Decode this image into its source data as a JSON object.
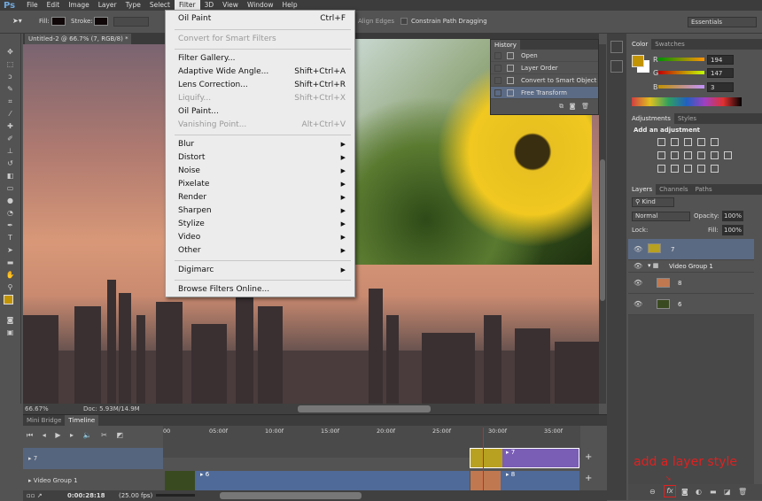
{
  "app": {
    "logo": "Ps"
  },
  "menubar": [
    "File",
    "Edit",
    "Image",
    "Layer",
    "Type",
    "Select",
    "Filter",
    "3D",
    "View",
    "Window",
    "Help"
  ],
  "options": {
    "fill": "Fill:",
    "stroke": "Stroke:",
    "align_edges": "Align Edges",
    "constrain": "Constrain Path Dragging",
    "workspace": "Essentials"
  },
  "document": {
    "tab": "Untitled-2 @ 66.7% (7, RGB/8) *",
    "close": "×",
    "zoom": "66.67%",
    "doc_size": "Doc: 5.93M/14.9M"
  },
  "filter_menu": [
    {
      "label": "Oil Paint",
      "shortcut": "Ctrl+F"
    },
    {
      "label": "Convert for Smart Filters",
      "disabled": true
    },
    {
      "label": "Filter Gallery..."
    },
    {
      "label": "Adaptive Wide Angle...",
      "shortcut": "Shift+Ctrl+A"
    },
    {
      "label": "Lens Correction...",
      "shortcut": "Shift+Ctrl+R"
    },
    {
      "label": "Liquify...",
      "shortcut": "Shift+Ctrl+X",
      "disabled": true
    },
    {
      "label": "Oil Paint..."
    },
    {
      "label": "Vanishing Point...",
      "shortcut": "Alt+Ctrl+V",
      "disabled": true
    },
    {
      "label": "Blur",
      "submenu": true
    },
    {
      "label": "Distort",
      "submenu": true
    },
    {
      "label": "Noise",
      "submenu": true
    },
    {
      "label": "Pixelate",
      "submenu": true
    },
    {
      "label": "Render",
      "submenu": true
    },
    {
      "label": "Sharpen",
      "submenu": true
    },
    {
      "label": "Stylize",
      "submenu": true
    },
    {
      "label": "Video",
      "submenu": true
    },
    {
      "label": "Other",
      "submenu": true
    },
    {
      "label": "Digimarc",
      "submenu": true
    },
    {
      "label": "Browse Filters Online..."
    }
  ],
  "history": {
    "title": "History",
    "items": [
      "Open",
      "Layer Order",
      "Convert to Smart Object",
      "Free Transform"
    ],
    "selected": 3
  },
  "color": {
    "tabs": [
      "Color",
      "Swatches"
    ],
    "r": "194",
    "g": "147",
    "b": "3",
    "labels": [
      "R",
      "G",
      "B"
    ],
    "foreground": "#c29303"
  },
  "adjustments": {
    "tabs": [
      "Adjustments",
      "Styles"
    ],
    "heading": "Add an adjustment"
  },
  "layers": {
    "tabs": [
      "Layers",
      "Channels",
      "Paths"
    ],
    "kind": "Kind",
    "blend": "Normal",
    "opacity_label": "Opacity:",
    "opacity": "100%",
    "lock_label": "Lock:",
    "fill_label": "Fill:",
    "fill": "100%",
    "items": [
      {
        "name": "7",
        "selected": true
      },
      {
        "name": "Video Group 1",
        "group": true
      },
      {
        "name": "8"
      },
      {
        "name": "6"
      }
    ]
  },
  "annotation": {
    "text": "add a layer style",
    "color": "#e02020"
  },
  "timeline": {
    "tabs": [
      "Mini Bridge",
      "Timeline"
    ],
    "ticks": [
      "00",
      "05:00f",
      "10:00f",
      "15:00f",
      "20:00f",
      "25:00f",
      "30:00f",
      "35:00f"
    ],
    "tracks": [
      "7",
      "Video Group 1"
    ],
    "clips": [
      "7",
      "6",
      "8"
    ],
    "timecode": "0:00:28:18",
    "fps": "(25.00 fps)"
  }
}
